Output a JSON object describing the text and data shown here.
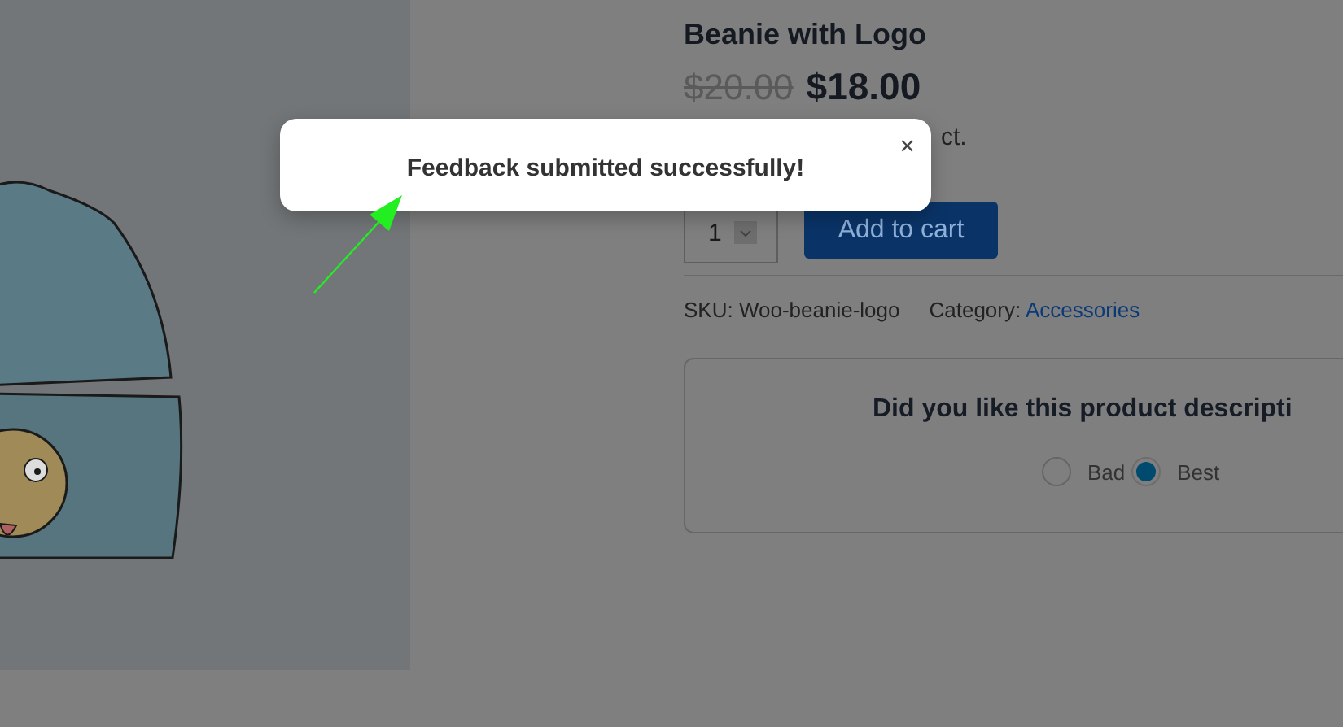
{
  "product": {
    "title": "Beanie with Logo",
    "old_price": "$20.00",
    "price": "$18.00",
    "description_tail": "ct.",
    "quantity": "1",
    "add_to_cart": "Add to cart",
    "sku_label": "SKU:",
    "sku": "Woo-beanie-logo",
    "category_label": "Category:",
    "category": "Accessories"
  },
  "feedback": {
    "question": "Did you like this product descripti",
    "options": [
      {
        "label": "Bad",
        "selected": false
      },
      {
        "label": "Best",
        "selected": true
      }
    ]
  },
  "toast": {
    "message": "Feedback submitted successfully!",
    "close": "×"
  }
}
